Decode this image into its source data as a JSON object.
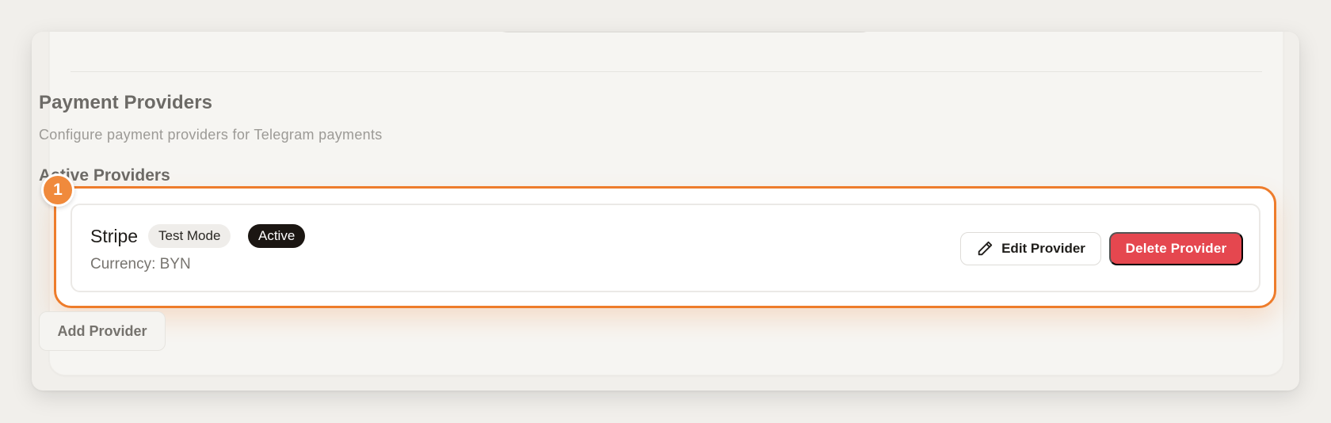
{
  "section": {
    "title": "Payment Providers",
    "description": "Configure payment providers for Telegram payments",
    "active_title": "Active Providers",
    "add_label": "Add Provider"
  },
  "highlight": {
    "marker": "1",
    "color": "#ee7c2b"
  },
  "provider": {
    "name": "Stripe",
    "badges": {
      "mode": "Test Mode",
      "status": "Active"
    },
    "currency": "Currency: BYN",
    "edit_label": "Edit Provider",
    "delete_label": "Delete Provider",
    "edit_icon": "pencil-icon"
  },
  "colors": {
    "accent": "#ee7c2b",
    "danger": "#e5474f",
    "active_badge": "#1b1612"
  }
}
